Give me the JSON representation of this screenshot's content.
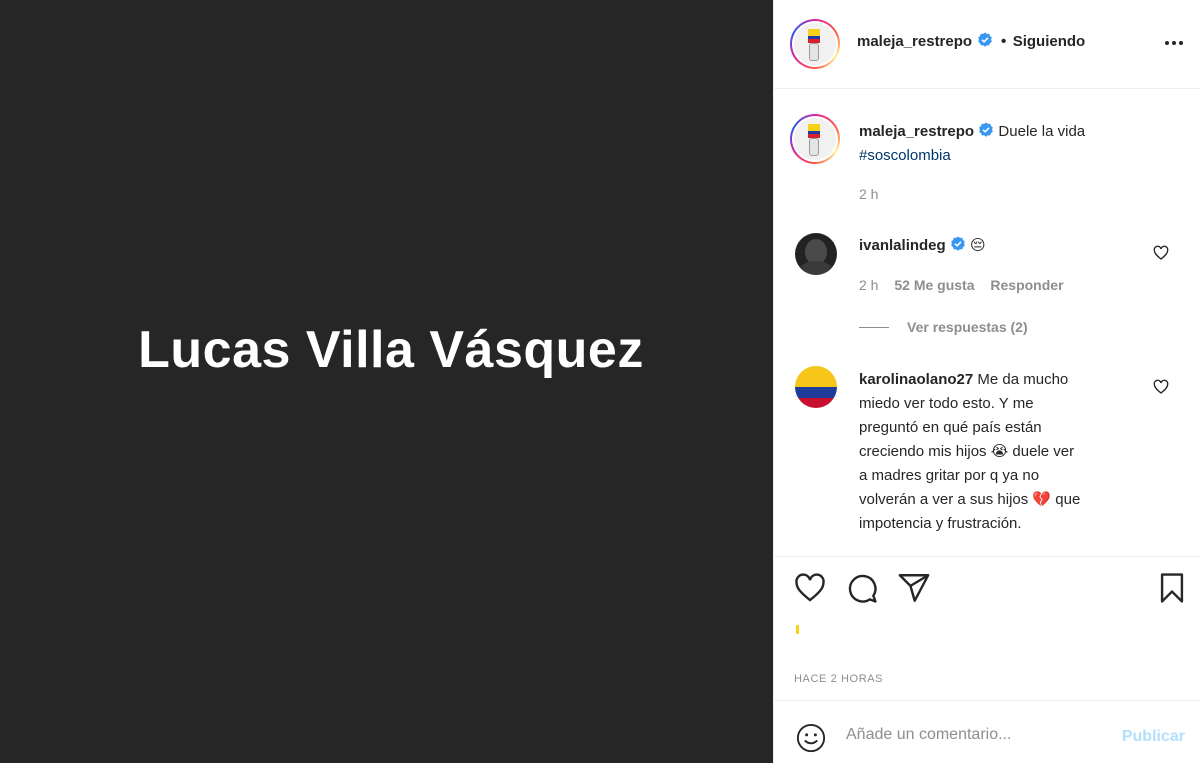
{
  "media": {
    "overlay_text": "Lucas Villa Vásquez"
  },
  "header": {
    "username": "maleja_restrepo",
    "separator": "•",
    "follow_status": "Siguiendo"
  },
  "caption": {
    "username": "maleja_restrepo",
    "text": "Duele la vida",
    "hashtag": "#soscolombia",
    "time": "2 h"
  },
  "comments": [
    {
      "username": "ivanlalindeg",
      "emoji": "😔",
      "time": "2 h",
      "likes": "52 Me gusta",
      "reply_label": "Responder",
      "view_replies": "Ver respuestas (2)"
    },
    {
      "username": "karolinaolano27",
      "lines": [
        "Me da mucho",
        "miedo ver todo esto. Y me",
        "preguntó en qué país están",
        "creciendo mis hijos 😭 duele ver",
        "a madres gritar por q ya no",
        "volverán a ver a sus hijos 💔 que",
        "impotencia y frustración."
      ]
    }
  ],
  "post_date": "HACE 2 HORAS",
  "add_comment": {
    "placeholder": "Añade un comentario...",
    "publish_label": "Publicar"
  },
  "colors": {
    "verified": "#3897f0",
    "hashtag": "#00376b",
    "secondary": "#8e8e8e",
    "publish_disabled": "#b2dffc"
  }
}
